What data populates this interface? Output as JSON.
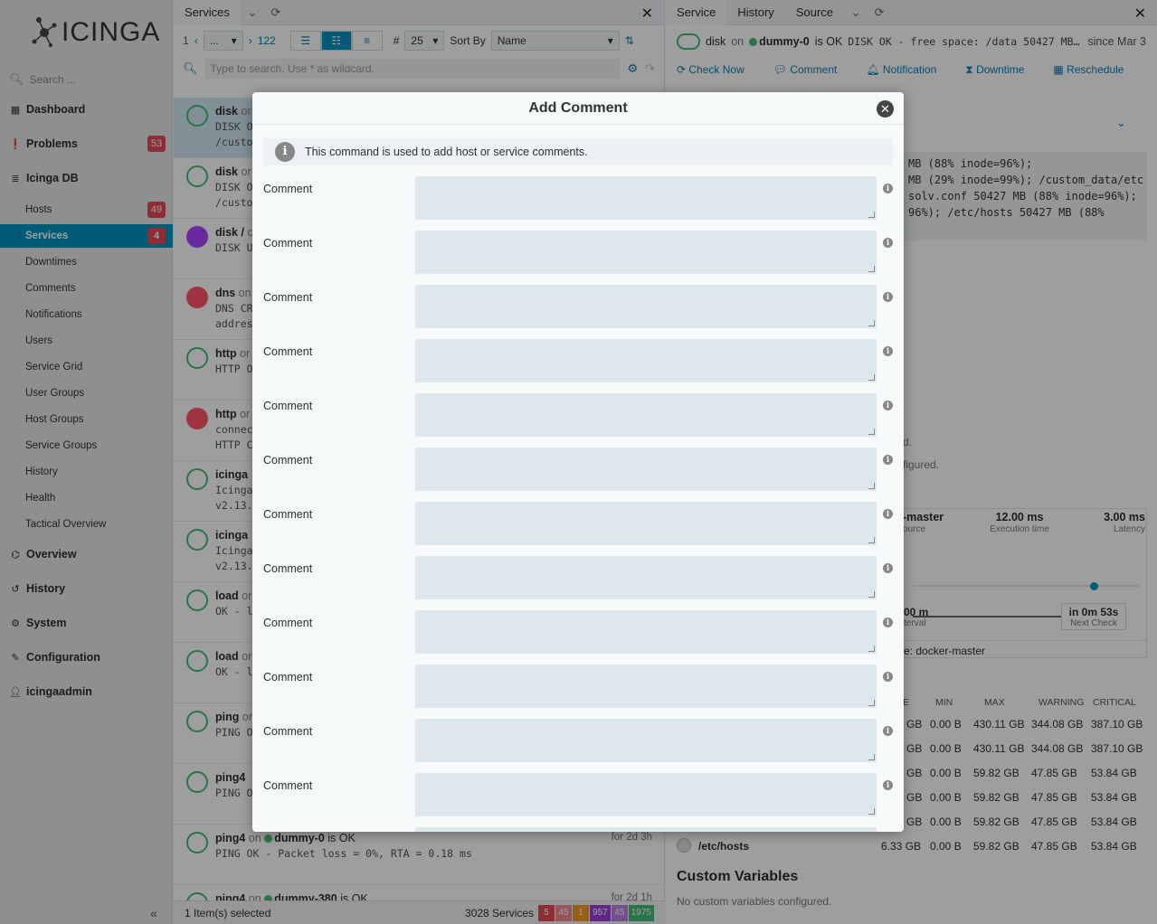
{
  "sidebar": {
    "logo": "ICINGA",
    "search_placeholder": "Search ...",
    "items": [
      {
        "label": "Dashboard",
        "icon": "grid-icon"
      },
      {
        "label": "Problems",
        "icon": "exclamation-icon",
        "badge": "53"
      },
      {
        "label": "Icinga DB",
        "icon": "database-icon"
      },
      {
        "label": "Overview",
        "icon": "binoculars-icon"
      },
      {
        "label": "History",
        "icon": "history-icon"
      },
      {
        "label": "System",
        "icon": "gears-icon"
      },
      {
        "label": "Configuration",
        "icon": "wrench-icon"
      },
      {
        "label": "icingaadmin",
        "icon": "user-icon"
      }
    ],
    "subitems": [
      {
        "label": "Hosts",
        "badge": "49"
      },
      {
        "label": "Services",
        "badge": "4"
      },
      {
        "label": "Downtimes"
      },
      {
        "label": "Comments"
      },
      {
        "label": "Notifications"
      },
      {
        "label": "Users"
      },
      {
        "label": "Service Grid"
      },
      {
        "label": "User Groups"
      },
      {
        "label": "Host Groups"
      },
      {
        "label": "Service Groups"
      },
      {
        "label": "History"
      },
      {
        "label": "Health"
      },
      {
        "label": "Tactical Overview"
      }
    ]
  },
  "list": {
    "tab": "Services",
    "page_first": "1",
    "page_sel": "...",
    "page_last": "122",
    "limit_label": "#",
    "limit": "25",
    "sort_label": "Sort By",
    "sort_value": "Name",
    "search_placeholder": "Type to search. Use * as wildcard.",
    "rows": [
      {
        "name": "disk",
        "on": "or",
        "l2": "DISK O",
        "l3": "/custo",
        "state": "ok"
      },
      {
        "name": "disk",
        "on": "or",
        "l2": "DISK O",
        "l3": "/custo",
        "state": "ok"
      },
      {
        "name": "disk /",
        "on": "c",
        "l2": "DISK U",
        "l3": "",
        "state": "unknown"
      },
      {
        "name": "dns",
        "on": "on",
        "l2": "DNS CR",
        "l3": "addres",
        "state": "critical"
      },
      {
        "name": "http",
        "on": "or",
        "l2": "HTTP O",
        "l3": "",
        "state": "ok"
      },
      {
        "name": "http",
        "on": "or",
        "l2": "connec",
        "l3": "HTTP C",
        "state": "critical"
      },
      {
        "name": "icinga",
        "on": "",
        "l2": "Icinga",
        "l3": "v2.13.",
        "state": "ok"
      },
      {
        "name": "icinga",
        "on": "",
        "l2": "Icinga",
        "l3": "v2.13.",
        "state": "ok"
      },
      {
        "name": "load",
        "on": "or",
        "l2": "OK - l",
        "l3": "",
        "state": "ok"
      },
      {
        "name": "load",
        "on": "or",
        "l2": "OK - l",
        "l3": "",
        "state": "ok"
      },
      {
        "name": "ping",
        "on": "or",
        "l2": "PING O",
        "l3": "",
        "state": "ok"
      },
      {
        "name": "ping4",
        "on": "",
        "l2": "PING O",
        "l3": "",
        "state": "ok"
      },
      {
        "name": "ping4",
        "on": "on",
        "host": "dummy-0",
        "status": "is OK",
        "l2": "PING OK - Packet loss = 0%, RTA = 0.18 ms",
        "since": "for 2d 3h",
        "state": "ok"
      },
      {
        "name": "ping4",
        "on": "on",
        "host": "dummy-380",
        "status": "is OK",
        "l2": "",
        "since": "for 2d 1h",
        "state": "ok"
      }
    ],
    "footer": {
      "selected": "1 Item(s) selected",
      "total": "3028 Services",
      "counts": [
        {
          "v": "5",
          "c": "#e64b55"
        },
        {
          "v": "45",
          "c": "#f08a91"
        },
        {
          "v": "1",
          "c": "#f29c21"
        },
        {
          "v": "957",
          "c": "#9b3fd9"
        },
        {
          "v": "45",
          "c": "#b884e0"
        },
        {
          "v": "1975",
          "c": "#44bb77"
        }
      ]
    }
  },
  "detail": {
    "tabs": [
      "Service",
      "History",
      "Source"
    ],
    "svc": "disk",
    "on": "on",
    "host": "dummy-0",
    "status": "is OK",
    "output": "DISK OK - free space: /data 50427 MB…",
    "since": "since Mar 3",
    "actions": [
      "Check Now",
      "Comment",
      "Notification",
      "Downtime",
      "Reschedule"
    ],
    "pre_lines": [
      "MB (88% inode=96%);",
      "MB (29% inode=99%); /custom_data/etc",
      "solv.conf 50427 MB (88% inode=96%);",
      "96%); /etc/hosts 50427 MB (88%"
    ],
    "frag1": "d.",
    "frag2": "figured.",
    "perf": [
      {
        "v": "-master",
        "l": "ource"
      },
      {
        "v": "12.00 ms",
        "l": "Execution time"
      },
      {
        "v": "3.00 ms",
        "l": "Latency"
      }
    ],
    "interval_v": "00 m",
    "interval_l": "terval",
    "next_v": "in 0m 53s",
    "next_l": "Next Check",
    "endpoint": "e: docker-master",
    "pd_head": [
      "E",
      "MIN",
      "MAX",
      "WARNING",
      "CRITICAL"
    ],
    "pd_rows": [
      [
        "GB",
        "0.00 B",
        "430.11 GB",
        "344.08 GB",
        "387.10 GB"
      ],
      [
        "GB",
        "0.00 B",
        "430.11 GB",
        "344.08 GB",
        "387.10 GB"
      ],
      [
        "GB",
        "0.00 B",
        "59.82 GB",
        "47.85 GB",
        "53.84 GB"
      ],
      [
        "GB",
        "0.00 B",
        "59.82 GB",
        "47.85 GB",
        "53.84 GB"
      ],
      [
        "GB",
        "0.00 B",
        "59.82 GB",
        "47.85 GB",
        "53.84 GB"
      ]
    ],
    "pd_last": {
      "name": "/etc/hosts",
      "value": "6.33 GB",
      "min": "0.00 B",
      "max": "59.82 GB",
      "warn": "47.85 GB",
      "crit": "53.84 GB"
    },
    "cv_title": "Custom Variables",
    "cv_empty": "No custom variables configured."
  },
  "modal": {
    "title": "Add Comment",
    "info": "This command is used to add host or service comments.",
    "field_label": "Comment",
    "fields": 12
  }
}
